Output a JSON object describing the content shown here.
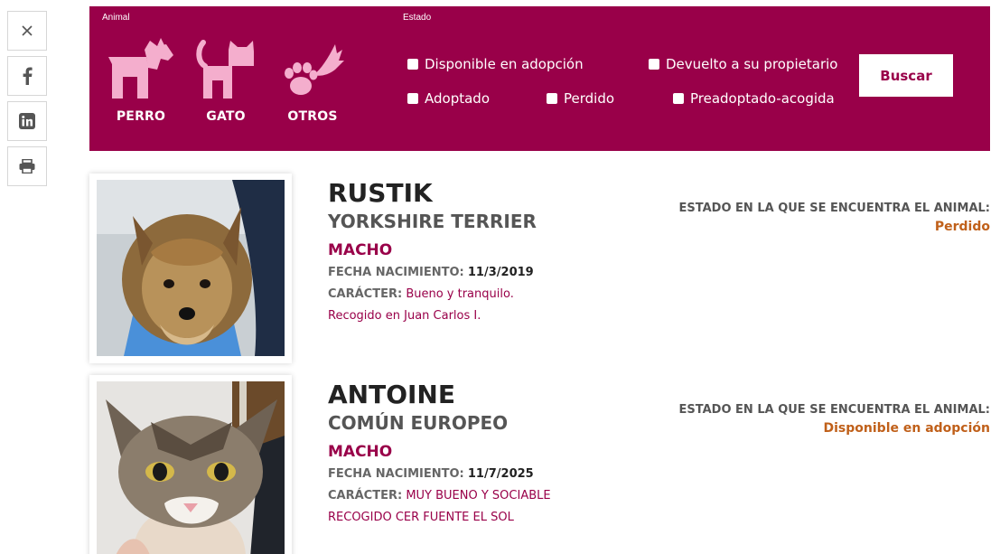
{
  "share": {
    "items": [
      {
        "name": "x-icon"
      },
      {
        "name": "facebook-icon"
      },
      {
        "name": "linkedin-icon"
      },
      {
        "name": "print-icon"
      }
    ]
  },
  "filter": {
    "animal_label": "Animal",
    "estado_label": "Estado",
    "animals": [
      {
        "label": "PERRO",
        "icon": "dog-icon"
      },
      {
        "label": "GATO",
        "icon": "cat-icon"
      },
      {
        "label": "OTROS",
        "icon": "paw-feather-icon"
      }
    ],
    "estados": [
      "Disponible en adopción",
      "Devuelto a su propietario",
      "Adoptado",
      "Perdido",
      "Preadoptado-acogida"
    ],
    "search_label": "Buscar",
    "colors": {
      "brand": "#990049",
      "status": "#c0601a"
    }
  },
  "results": [
    {
      "name": "RUSTIK",
      "breed": "YORKSHIRE TERRIER",
      "sex": "MACHO",
      "birth_label": "FECHA NACIMIENTO:",
      "birth": "11/3/2019",
      "character_label": "CARÁCTER:",
      "character": "Bueno y tranquilo.",
      "note": "Recogido en Juan Carlos I.",
      "status_label": "ESTADO EN LA QUE SE ENCUENTRA EL ANIMAL:",
      "status": "Perdido",
      "photo": "yorkshire-dog-photo"
    },
    {
      "name": "ANTOINE",
      "breed": "COMÚN EUROPEO",
      "sex": "MACHO",
      "birth_label": "FECHA NACIMIENTO:",
      "birth": "11/7/2025",
      "character_label": "CARÁCTER:",
      "character": "MUY BUENO Y SOCIABLE",
      "note": "RECOGIDO CER FUENTE EL SOL",
      "status_label": "ESTADO EN LA QUE SE ENCUENTRA EL ANIMAL:",
      "status": "Disponible en adopción",
      "photo": "tabby-cat-photo"
    }
  ]
}
